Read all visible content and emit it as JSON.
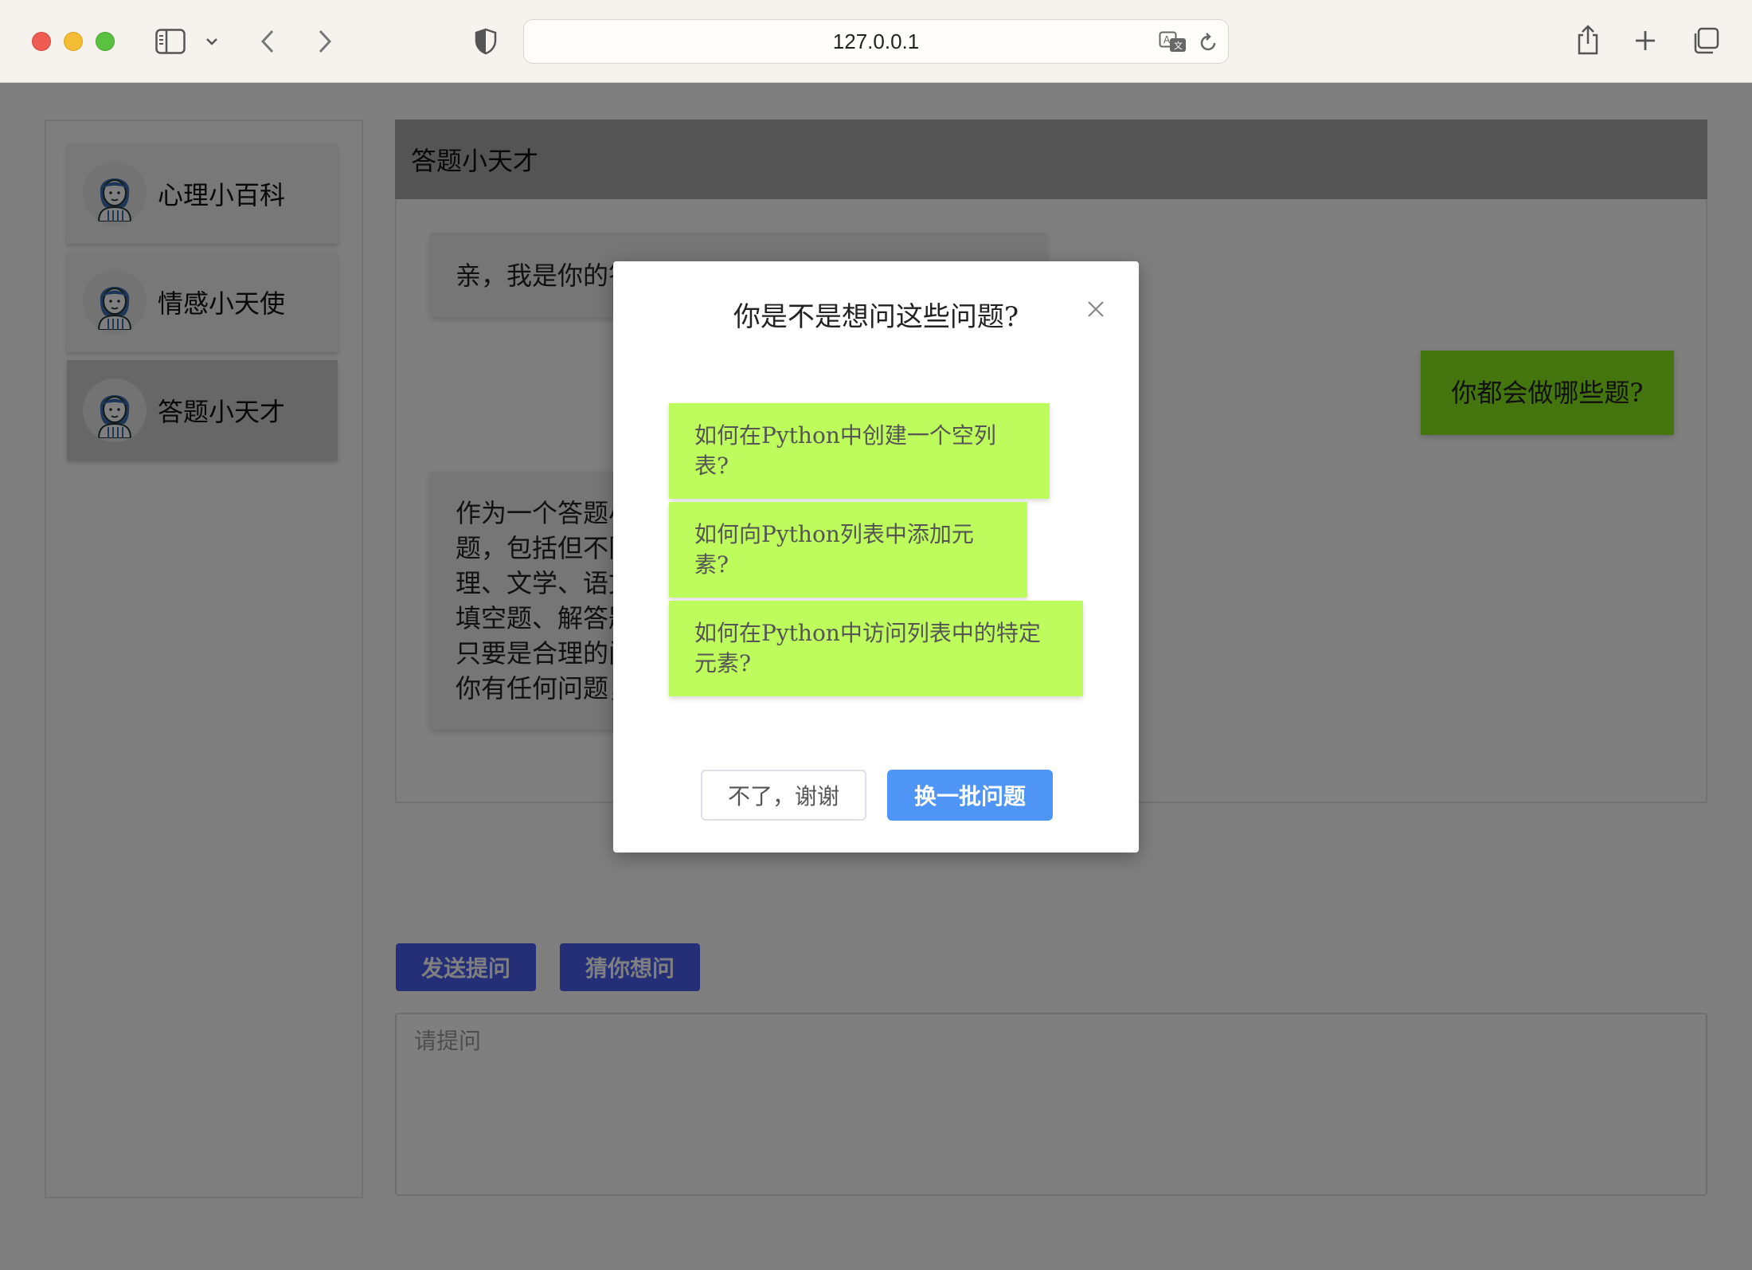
{
  "browser": {
    "url": "127.0.0.1"
  },
  "sidebar": {
    "items": [
      {
        "label": "心理小百科"
      },
      {
        "label": "情感小天使"
      },
      {
        "label": "答题小天才"
      }
    ],
    "active_index": 2
  },
  "chat": {
    "header_title": "答题小天才",
    "messages": [
      {
        "role": "bot",
        "text": "亲，我是你的答题小天才"
      },
      {
        "role": "user",
        "text": "你都会做哪些题?"
      },
      {
        "role": "bot",
        "lines": [
          "作为一个答题小天才，我可以帮助你解答各种问",
          "题，包括但不限于数学、物理、化学、生物、地",
          "理、文学、语文、历史等学科的选择题、判断题、",
          "填空题、解答题等。无论题目难易，无论题型，",
          "只要是合理的问题，我都会尽力帮助你解答。如果",
          "你有任何问题，欢迎随时向我提问！"
        ]
      }
    ]
  },
  "actions": {
    "send_label": "发送提问",
    "guess_label": "猜你想问"
  },
  "input": {
    "placeholder": "请提问",
    "value": ""
  },
  "modal": {
    "title": "你是不是想问这些问题?",
    "suggestions": [
      "如何在Python中创建一个空列表?",
      "如何向Python列表中添加元素?",
      "如何在Python中访问列表中的特定元素?"
    ],
    "cancel_label": "不了，谢谢",
    "refresh_label": "换一批问题"
  },
  "colors": {
    "user_bubble": "#8bea1c",
    "suggestion_bg": "#bdfc5c",
    "action_button": "#4a5ef1",
    "modal_primary": "#4e95f5"
  }
}
